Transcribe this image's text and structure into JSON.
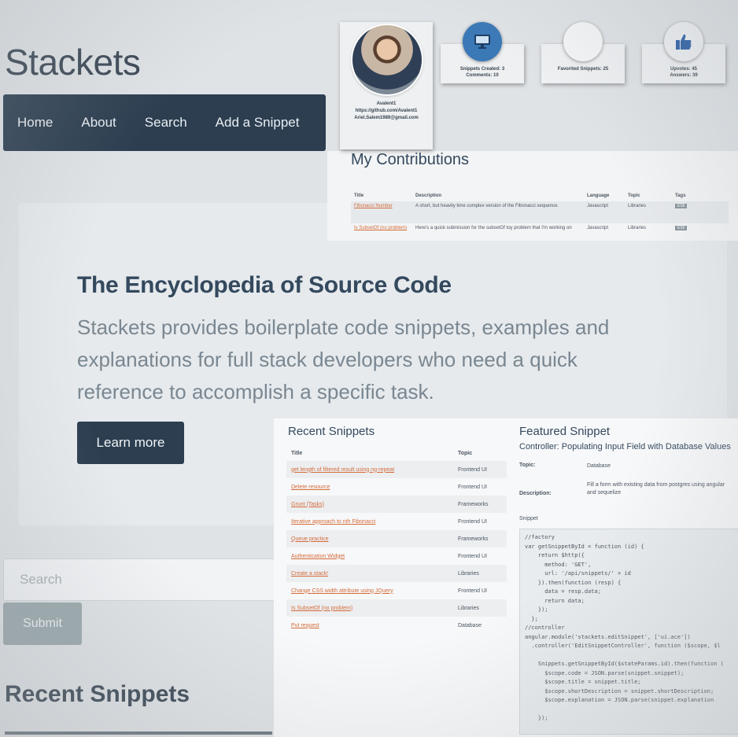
{
  "brand": "Stackets",
  "nav": [
    "Home",
    "About",
    "Search",
    "Add a Snippet"
  ],
  "jumbotron": {
    "title": "The Encyclopedia of Source Code",
    "text": "Stackets provides boilerplate code snippets, examples and explanations for full stack developers who need a quick reference to accomplish a specific task.",
    "button": "Learn more"
  },
  "search": {
    "placeholder": "Search",
    "submit": "Submit"
  },
  "recent_heading": "Recent Snippets",
  "profile": {
    "name": "Avalent1",
    "github": "https://github.com/Avalent1",
    "email": "Ariel.Salem1989@gmail.com"
  },
  "stats": {
    "created": "Snippets Created: 3",
    "comments": "Comments: 10",
    "favorited": "Favorited Snippets: 25",
    "upvotes": "Upvotes: 45",
    "answers": "Answers: 39"
  },
  "contributions": {
    "title": "My Contributions",
    "headers": [
      "Title",
      "Description",
      "Language",
      "Topic",
      "Tags"
    ],
    "rows": [
      {
        "title": "Fibonacci Number",
        "description": "A short, but heavily time complex version of the Fibonacci sequence.",
        "language": "Javascript",
        "topic": "Libraries",
        "tag": "ES6"
      },
      {
        "title": "Is SubsetOf (no problem)",
        "description": "Here's a quick submission for the subsetOf toy problem that I'm working on",
        "language": "Javascript",
        "topic": "Libraries",
        "tag": "ES6"
      }
    ]
  },
  "recent_snippets": {
    "title": "Recent Snippets",
    "headers": [
      "Title",
      "Topic"
    ],
    "rows": [
      {
        "title": "get length of filtered result using ng-repeat",
        "topic": "Frontend UI"
      },
      {
        "title": "Delete resource",
        "topic": "Frontend UI"
      },
      {
        "title": "Grunt (Tasks)",
        "topic": "Frameworks"
      },
      {
        "title": "Iterative approach to nth Fibonacci",
        "topic": "Frontend UI"
      },
      {
        "title": "Queue practice",
        "topic": "Frameworks"
      },
      {
        "title": "Authentication Widget",
        "topic": "Frontend UI"
      },
      {
        "title": "Create a stack!",
        "topic": "Libraries"
      },
      {
        "title": "Change CSS width attribute using JQuery",
        "topic": "Frontend UI"
      },
      {
        "title": "Is SubsetOf (no problem)",
        "topic": "Libraries"
      },
      {
        "title": "Put request",
        "topic": "Database"
      }
    ]
  },
  "featured": {
    "title": "Featured Snippet",
    "subtitle": "Controller: Populating Input Field with Database Values",
    "topic_label": "Topic:",
    "topic": "Database",
    "description_label": "Description:",
    "description": "Fill a form with existing data from postgres using angular and sequelize",
    "snippet_label": "Snippet",
    "code": "//factory\nvar getSnippetById = function (id) {\n    return $http({\n      method: 'GET',\n      url: '/api/snippets/' + id\n    }).then(function (resp) {\n      data = resp.data;\n      return data;\n    });\n  };\n//controller\nangular.module('stackets.editSnippet', ['ui.ace'])\n  .controller('EditSnippetController', function ($scope, $l\n\n    Snippets.getSnippetById($stateParams.id).then(function (\n      $scope.code = JSON.parse(snippet.snippet);\n      $scope.title = snippet.title;\n      $scope.shortDescription = snippet.shortDescription;\n      $scope.explanation = JSON.parse(snippet.explanation\n\n    });"
  }
}
